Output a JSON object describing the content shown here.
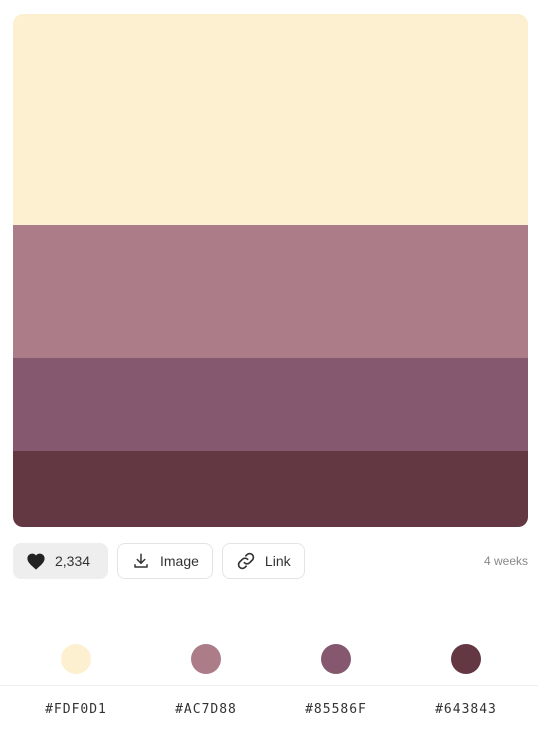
{
  "palette": {
    "colors": [
      "#FDF0D1",
      "#AC7D88",
      "#85586F",
      "#643843"
    ]
  },
  "actions": {
    "likes_count": "2,334",
    "image_label": "Image",
    "link_label": "Link",
    "time_ago": "4 weeks"
  },
  "icons": {
    "like": "heart-icon",
    "image": "download-icon",
    "link": "link-icon"
  },
  "codes": {
    "c0": "#FDF0D1",
    "c1": "#AC7D88",
    "c2": "#85586F",
    "c3": "#643843"
  }
}
